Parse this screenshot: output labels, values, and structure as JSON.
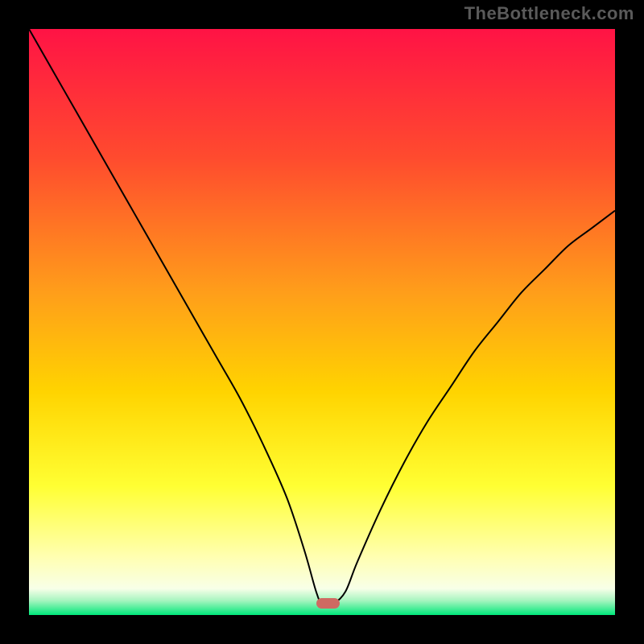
{
  "watermark": "TheBottleneck.com",
  "chart_data": {
    "type": "line",
    "title": "",
    "xlabel": "",
    "ylabel": "",
    "xlim": [
      0,
      100
    ],
    "ylim": [
      0,
      100
    ],
    "grid": false,
    "legend": false,
    "background_gradient": {
      "stops": [
        {
          "offset": 0.0,
          "color": "#ff1345"
        },
        {
          "offset": 0.22,
          "color": "#ff4b2e"
        },
        {
          "offset": 0.45,
          "color": "#ff9e1a"
        },
        {
          "offset": 0.62,
          "color": "#ffd400"
        },
        {
          "offset": 0.78,
          "color": "#ffff33"
        },
        {
          "offset": 0.9,
          "color": "#ffffb0"
        },
        {
          "offset": 0.955,
          "color": "#f8ffe8"
        },
        {
          "offset": 0.975,
          "color": "#a8f5c0"
        },
        {
          "offset": 1.0,
          "color": "#00e77a"
        }
      ]
    },
    "series": [
      {
        "name": "bottleneck-curve",
        "color": "#000000",
        "stroke_width": 2,
        "x": [
          0,
          4,
          8,
          12,
          16,
          20,
          24,
          28,
          32,
          36,
          40,
          44,
          47,
          49,
          50,
          52,
          54,
          56,
          60,
          64,
          68,
          72,
          76,
          80,
          84,
          88,
          92,
          96,
          100
        ],
        "y": [
          100,
          93,
          86,
          79,
          72,
          65,
          58,
          51,
          44,
          37,
          29,
          20,
          11,
          4,
          2,
          2,
          4,
          9,
          18,
          26,
          33,
          39,
          45,
          50,
          55,
          59,
          63,
          66,
          69
        ]
      }
    ],
    "marker": {
      "name": "optimal-range",
      "color": "#cf6a62",
      "x_start": 49,
      "x_end": 53,
      "y": 2,
      "height_pct": 1.8
    }
  }
}
